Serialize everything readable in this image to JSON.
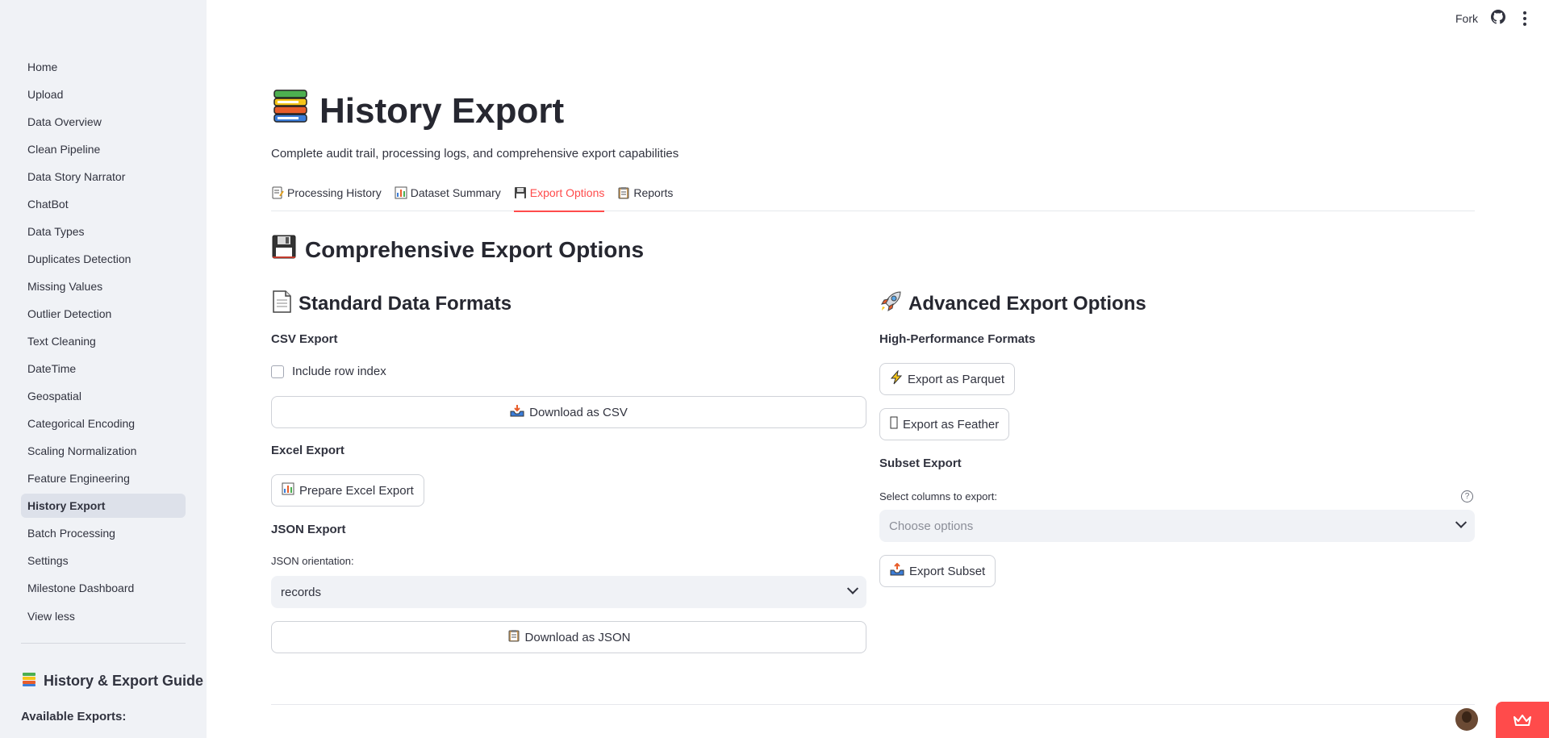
{
  "header": {
    "fork_label": "Fork"
  },
  "sidebar": {
    "items": [
      {
        "label": "Home"
      },
      {
        "label": "Upload"
      },
      {
        "label": "Data Overview"
      },
      {
        "label": "Clean Pipeline"
      },
      {
        "label": "Data Story Narrator"
      },
      {
        "label": "ChatBot"
      },
      {
        "label": "Data Types"
      },
      {
        "label": "Duplicates Detection"
      },
      {
        "label": "Missing Values"
      },
      {
        "label": "Outlier Detection"
      },
      {
        "label": "Text Cleaning"
      },
      {
        "label": "DateTime"
      },
      {
        "label": "Geospatial"
      },
      {
        "label": "Categorical Encoding"
      },
      {
        "label": "Scaling Normalization"
      },
      {
        "label": "Feature Engineering"
      },
      {
        "label": "History Export",
        "active": true
      },
      {
        "label": "Batch Processing"
      },
      {
        "label": "Settings"
      },
      {
        "label": "Milestone Dashboard"
      }
    ],
    "view_less": "View less",
    "guide_title": "History & Export Guide",
    "available_exports": "Available Exports:"
  },
  "page": {
    "title": "History Export",
    "subtitle": "Complete audit trail, processing logs, and comprehensive export capabilities"
  },
  "tabs": [
    {
      "label": "Processing History",
      "icon": "memo-icon"
    },
    {
      "label": "Dataset Summary",
      "icon": "bar-chart-icon"
    },
    {
      "label": "Export Options",
      "icon": "floppy-disk-icon",
      "active": true
    },
    {
      "label": "Reports",
      "icon": "clipboard-icon"
    }
  ],
  "section": {
    "title": "Comprehensive Export Options",
    "standard": {
      "title": "Standard Data Formats",
      "csv_label": "CSV Export",
      "include_index_label": "Include row index",
      "include_index_checked": false,
      "download_csv": "Download as CSV",
      "excel_label": "Excel Export",
      "prepare_excel": "Prepare Excel Export",
      "json_label": "JSON Export",
      "json_orientation_label": "JSON orientation:",
      "json_orientation_value": "records",
      "download_json": "Download as JSON"
    },
    "advanced": {
      "title": "Advanced Export Options",
      "hp_label": "High-Performance Formats",
      "export_parquet": "Export as Parquet",
      "export_feather": "Export as Feather",
      "subset_label": "Subset Export",
      "select_columns_label": "Select columns to export:",
      "select_columns_placeholder": "Choose options",
      "export_subset": "Export Subset"
    }
  },
  "colors": {
    "accent": "#ff4b4b",
    "sidebar_bg": "#f0f2f6",
    "text": "#31333f"
  }
}
